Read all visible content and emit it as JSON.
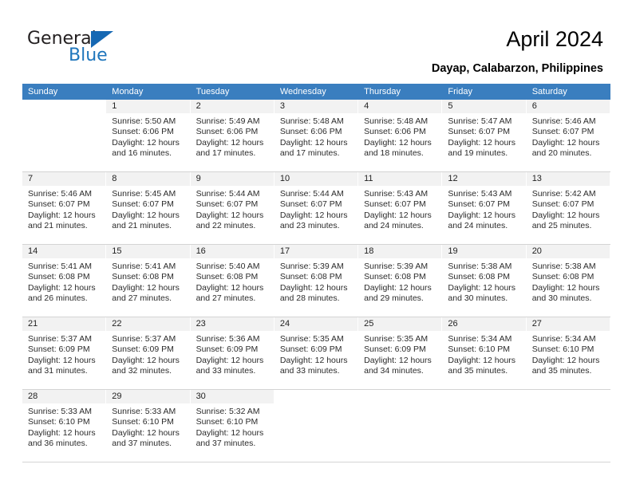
{
  "brand": {
    "name_part1": "General",
    "name_part2": "Blue",
    "accent_color": "#1668b3"
  },
  "header": {
    "title": "April 2024",
    "subtitle": "Dayap, Calabarzon, Philippines"
  },
  "calendar": {
    "header_bg": "#3a7ebf",
    "daynum_bg": "#f2f2f2",
    "weekdays": [
      "Sunday",
      "Monday",
      "Tuesday",
      "Wednesday",
      "Thursday",
      "Friday",
      "Saturday"
    ],
    "weeks": [
      [
        {
          "day": "",
          "blank": true,
          "lines": []
        },
        {
          "day": "1",
          "lines": [
            "Sunrise: 5:50 AM",
            "Sunset: 6:06 PM",
            "Daylight: 12 hours",
            "and 16 minutes."
          ]
        },
        {
          "day": "2",
          "lines": [
            "Sunrise: 5:49 AM",
            "Sunset: 6:06 PM",
            "Daylight: 12 hours",
            "and 17 minutes."
          ]
        },
        {
          "day": "3",
          "lines": [
            "Sunrise: 5:48 AM",
            "Sunset: 6:06 PM",
            "Daylight: 12 hours",
            "and 17 minutes."
          ]
        },
        {
          "day": "4",
          "lines": [
            "Sunrise: 5:48 AM",
            "Sunset: 6:06 PM",
            "Daylight: 12 hours",
            "and 18 minutes."
          ]
        },
        {
          "day": "5",
          "lines": [
            "Sunrise: 5:47 AM",
            "Sunset: 6:07 PM",
            "Daylight: 12 hours",
            "and 19 minutes."
          ]
        },
        {
          "day": "6",
          "lines": [
            "Sunrise: 5:46 AM",
            "Sunset: 6:07 PM",
            "Daylight: 12 hours",
            "and 20 minutes."
          ]
        }
      ],
      [
        {
          "day": "7",
          "lines": [
            "Sunrise: 5:46 AM",
            "Sunset: 6:07 PM",
            "Daylight: 12 hours",
            "and 21 minutes."
          ]
        },
        {
          "day": "8",
          "lines": [
            "Sunrise: 5:45 AM",
            "Sunset: 6:07 PM",
            "Daylight: 12 hours",
            "and 21 minutes."
          ]
        },
        {
          "day": "9",
          "lines": [
            "Sunrise: 5:44 AM",
            "Sunset: 6:07 PM",
            "Daylight: 12 hours",
            "and 22 minutes."
          ]
        },
        {
          "day": "10",
          "lines": [
            "Sunrise: 5:44 AM",
            "Sunset: 6:07 PM",
            "Daylight: 12 hours",
            "and 23 minutes."
          ]
        },
        {
          "day": "11",
          "lines": [
            "Sunrise: 5:43 AM",
            "Sunset: 6:07 PM",
            "Daylight: 12 hours",
            "and 24 minutes."
          ]
        },
        {
          "day": "12",
          "lines": [
            "Sunrise: 5:43 AM",
            "Sunset: 6:07 PM",
            "Daylight: 12 hours",
            "and 24 minutes."
          ]
        },
        {
          "day": "13",
          "lines": [
            "Sunrise: 5:42 AM",
            "Sunset: 6:07 PM",
            "Daylight: 12 hours",
            "and 25 minutes."
          ]
        }
      ],
      [
        {
          "day": "14",
          "lines": [
            "Sunrise: 5:41 AM",
            "Sunset: 6:08 PM",
            "Daylight: 12 hours",
            "and 26 minutes."
          ]
        },
        {
          "day": "15",
          "lines": [
            "Sunrise: 5:41 AM",
            "Sunset: 6:08 PM",
            "Daylight: 12 hours",
            "and 27 minutes."
          ]
        },
        {
          "day": "16",
          "lines": [
            "Sunrise: 5:40 AM",
            "Sunset: 6:08 PM",
            "Daylight: 12 hours",
            "and 27 minutes."
          ]
        },
        {
          "day": "17",
          "lines": [
            "Sunrise: 5:39 AM",
            "Sunset: 6:08 PM",
            "Daylight: 12 hours",
            "and 28 minutes."
          ]
        },
        {
          "day": "18",
          "lines": [
            "Sunrise: 5:39 AM",
            "Sunset: 6:08 PM",
            "Daylight: 12 hours",
            "and 29 minutes."
          ]
        },
        {
          "day": "19",
          "lines": [
            "Sunrise: 5:38 AM",
            "Sunset: 6:08 PM",
            "Daylight: 12 hours",
            "and 30 minutes."
          ]
        },
        {
          "day": "20",
          "lines": [
            "Sunrise: 5:38 AM",
            "Sunset: 6:08 PM",
            "Daylight: 12 hours",
            "and 30 minutes."
          ]
        }
      ],
      [
        {
          "day": "21",
          "lines": [
            "Sunrise: 5:37 AM",
            "Sunset: 6:09 PM",
            "Daylight: 12 hours",
            "and 31 minutes."
          ]
        },
        {
          "day": "22",
          "lines": [
            "Sunrise: 5:37 AM",
            "Sunset: 6:09 PM",
            "Daylight: 12 hours",
            "and 32 minutes."
          ]
        },
        {
          "day": "23",
          "lines": [
            "Sunrise: 5:36 AM",
            "Sunset: 6:09 PM",
            "Daylight: 12 hours",
            "and 33 minutes."
          ]
        },
        {
          "day": "24",
          "lines": [
            "Sunrise: 5:35 AM",
            "Sunset: 6:09 PM",
            "Daylight: 12 hours",
            "and 33 minutes."
          ]
        },
        {
          "day": "25",
          "lines": [
            "Sunrise: 5:35 AM",
            "Sunset: 6:09 PM",
            "Daylight: 12 hours",
            "and 34 minutes."
          ]
        },
        {
          "day": "26",
          "lines": [
            "Sunrise: 5:34 AM",
            "Sunset: 6:10 PM",
            "Daylight: 12 hours",
            "and 35 minutes."
          ]
        },
        {
          "day": "27",
          "lines": [
            "Sunrise: 5:34 AM",
            "Sunset: 6:10 PM",
            "Daylight: 12 hours",
            "and 35 minutes."
          ]
        }
      ],
      [
        {
          "day": "28",
          "lines": [
            "Sunrise: 5:33 AM",
            "Sunset: 6:10 PM",
            "Daylight: 12 hours",
            "and 36 minutes."
          ]
        },
        {
          "day": "29",
          "lines": [
            "Sunrise: 5:33 AM",
            "Sunset: 6:10 PM",
            "Daylight: 12 hours",
            "and 37 minutes."
          ]
        },
        {
          "day": "30",
          "lines": [
            "Sunrise: 5:32 AM",
            "Sunset: 6:10 PM",
            "Daylight: 12 hours",
            "and 37 minutes."
          ]
        },
        {
          "day": "",
          "blank": true,
          "lines": []
        },
        {
          "day": "",
          "blank": true,
          "lines": []
        },
        {
          "day": "",
          "blank": true,
          "lines": []
        },
        {
          "day": "",
          "blank": true,
          "lines": []
        }
      ]
    ]
  }
}
